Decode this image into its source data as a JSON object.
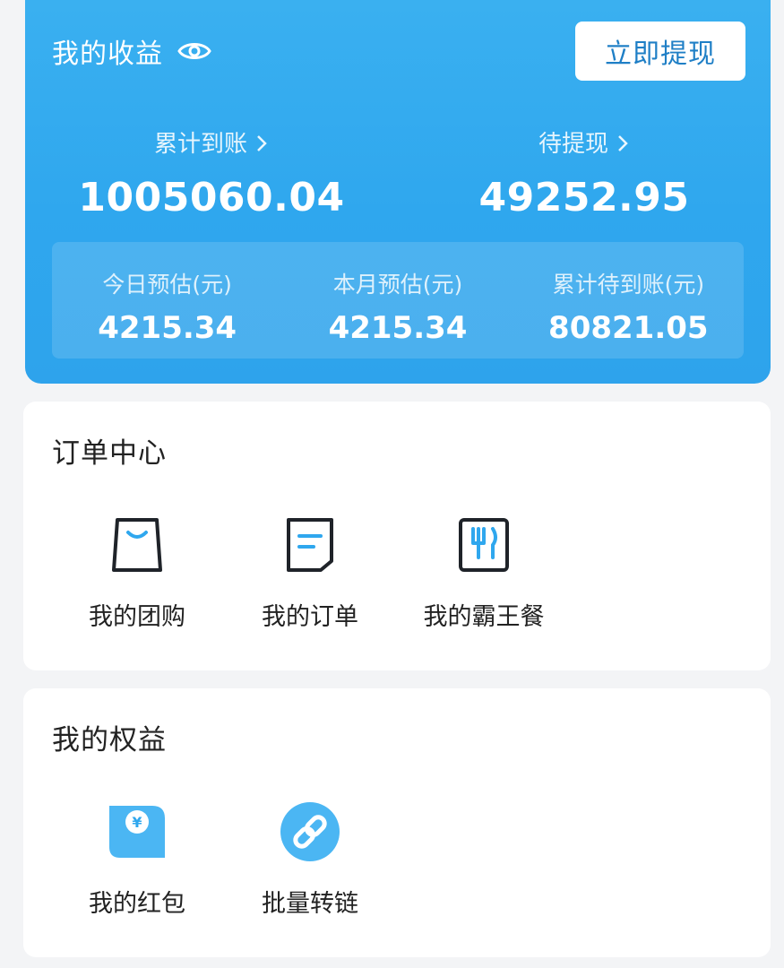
{
  "earnings": {
    "title": "我的收益",
    "eye_icon": "eye-icon",
    "withdraw_label": "立即提现",
    "cumulative_label": "累计到账",
    "cumulative_value": "1005060.04",
    "pending_label": "待提现",
    "pending_value": "49252.95",
    "estimates": [
      {
        "label": "今日预估(元)",
        "value": "4215.34"
      },
      {
        "label": "本月预估(元)",
        "value": "4215.34"
      },
      {
        "label": "累计待到账(元)",
        "value": "80821.05"
      }
    ]
  },
  "order_center": {
    "title": "订单中心",
    "items": [
      {
        "label": "我的团购",
        "icon": "shopping-bag-icon"
      },
      {
        "label": "我的订单",
        "icon": "order-list-icon"
      },
      {
        "label": "我的霸王餐",
        "icon": "utensils-icon"
      }
    ]
  },
  "my_rights": {
    "title": "我的权益",
    "items": [
      {
        "label": "我的红包",
        "icon": "red-packet-icon"
      },
      {
        "label": "批量转链",
        "icon": "link-icon"
      }
    ]
  },
  "colors": {
    "accent": "#2fa7ee",
    "button_text": "#1f7fc6",
    "text_dark": "#222222",
    "background": "#f3f4f6"
  }
}
